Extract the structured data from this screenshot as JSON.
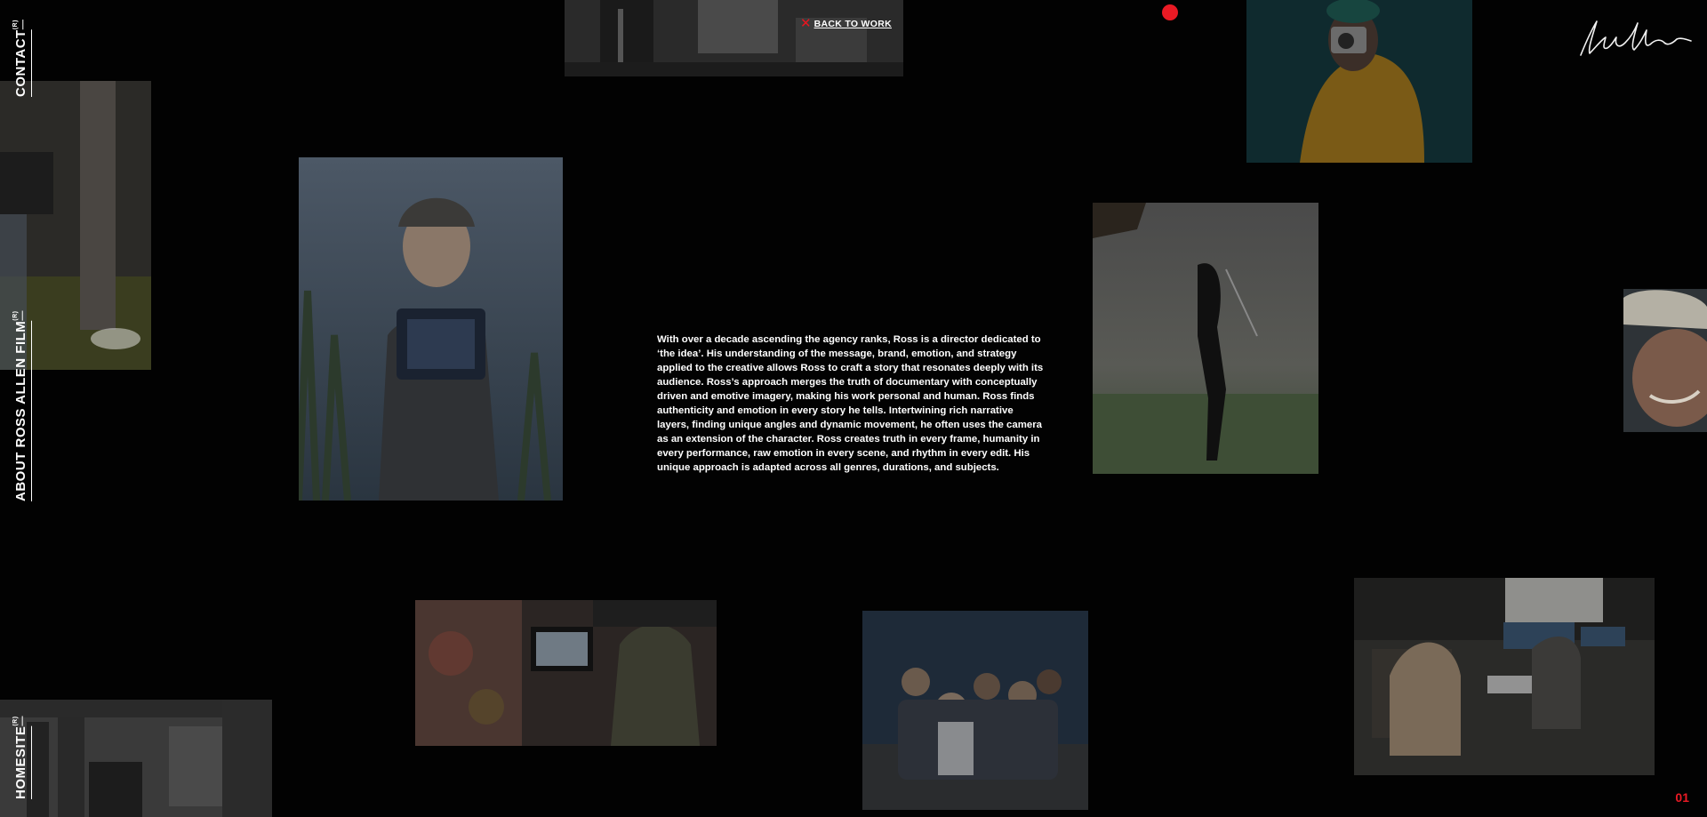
{
  "nav": {
    "contact": "CONTACT",
    "about": "ABOUT ROSS ALLEN FILM",
    "homesite": "HOMESITE",
    "superscript": "(R)"
  },
  "back_to_work": {
    "icon": "close-x-icon",
    "label": "BACK TO WORK"
  },
  "bio": "With over a decade ascending the agency ranks, Ross is a director dedicated to ‘the idea’. His understanding of the message, brand, emotion, and strategy applied to the creative allows Ross to craft a story that resonates deeply with its audience. Ross’s approach merges the truth of documentary with conceptually driven and emotive imagery, making his work personal and human. Ross finds authenticity and emotion in every story he tells. Intertwining rich narrative layers, finding unique angles and dynamic movement, he often uses the camera as an extension of the character. Ross creates truth in every frame, humanity in every performance, raw emotion in every scene, and rhythm in every edit. His unique approach is adapted across all genres, durations, and subjects.",
  "page_number": "01",
  "colors": {
    "background": "#020202",
    "accent": "#ea1a24",
    "text": "#ffffff"
  }
}
